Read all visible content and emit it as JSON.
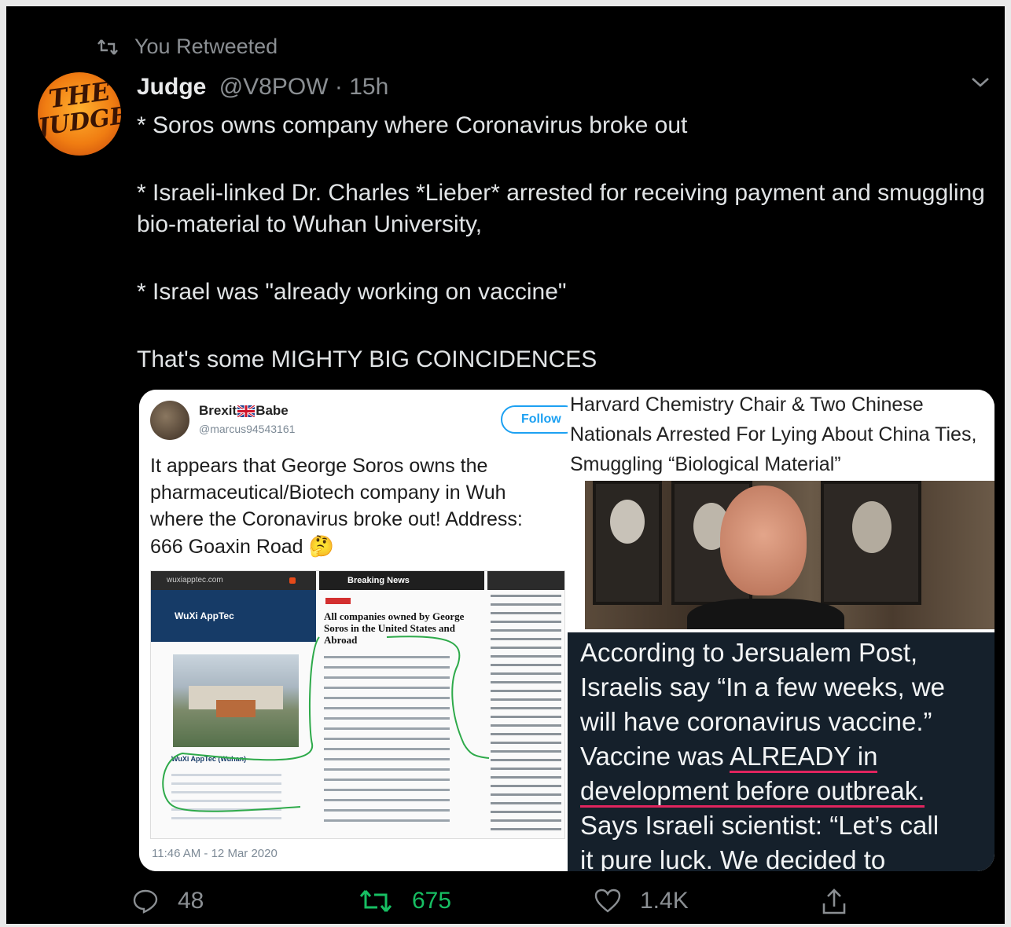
{
  "retweet_label": "You Retweeted",
  "avatar_text": {
    "line1": "THE",
    "line2": "JUDGE"
  },
  "author": {
    "name": "Judge",
    "handle": "@V8POW",
    "separator": "·",
    "time": "15h"
  },
  "tweet_paragraphs": [
    "* Soros owns company where Coronavirus broke out",
    "* Israeli-linked Dr. Charles *Lieber* arrested for receiving payment and smuggling bio-material to Wuhan University,",
    "* Israel was \"already working on vaccine\"",
    "That's some MIGHTY BIG COINCIDENCES"
  ],
  "embed_left": {
    "name_part1": "Brexit",
    "name_part2": "Babe",
    "handle": "@marcus94543161",
    "follow": "Follow",
    "text": "It appears that George Soros owns the pharmaceutical/Biotech company in Wuh where the Coronavirus broke out! Address: 666 Goaxin Road",
    "emoji": "🤔",
    "shot_url": "wuxiapptec.com",
    "shot_logo": "WuXi AppTec",
    "shot_tab": "Breaking News",
    "shot_heading": "All companies owned by George Soros in the United States and Abroad",
    "shot_caption": "WuXi AppTec (Wuhan)",
    "timestamp": "11:46 AM - 12 Mar 2020"
  },
  "embed_right_top": {
    "headline": "Harvard Chemistry Chair & Two Chinese Nationals Arrested For Lying About China Ties, Smuggling “Biological Material”"
  },
  "embed_right_bottom": {
    "l1": "According to Jersualem Post,",
    "l2": "Israelis say “In a few weeks, we",
    "l3": "will have coronavirus vaccine.”",
    "l4a": "Vaccine was ",
    "l4b": "ALREADY in",
    "l5": "development before outbreak.",
    "l6": "Says Israeli scientist: “Let’s call",
    "l7": "it pure luck. We decided to"
  },
  "actions": {
    "reply": "48",
    "retweet": "675",
    "like": "1.4K"
  },
  "colors": {
    "retweet_green": "#17bf63",
    "underline_red": "#e0245e",
    "muted": "#8b8f93"
  }
}
